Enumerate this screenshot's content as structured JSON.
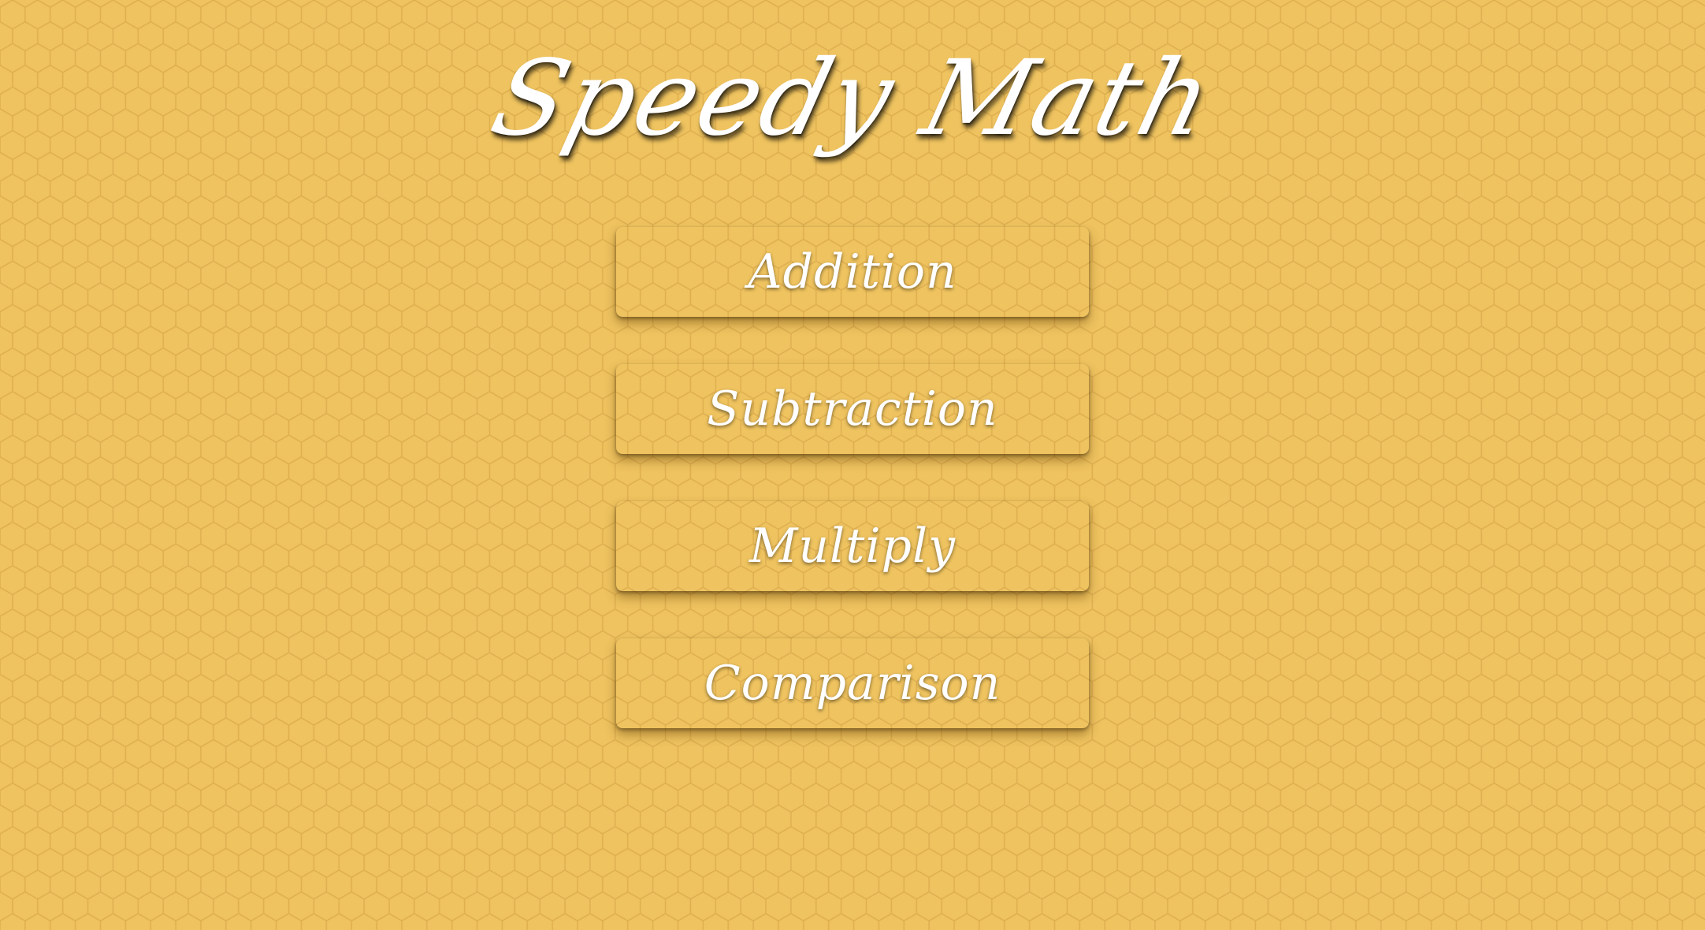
{
  "app": {
    "title": "Speedy Math"
  },
  "menu": {
    "items": [
      {
        "label": "Addition"
      },
      {
        "label": "Subtraction"
      },
      {
        "label": "Multiply"
      },
      {
        "label": "Comparison"
      }
    ]
  },
  "colors": {
    "background": "#efc35f",
    "honeycomb_line": "#d9a84a",
    "button_wood_dark": "#0c0502",
    "button_wood_light": "#4a2610",
    "text": "#ffffff"
  }
}
